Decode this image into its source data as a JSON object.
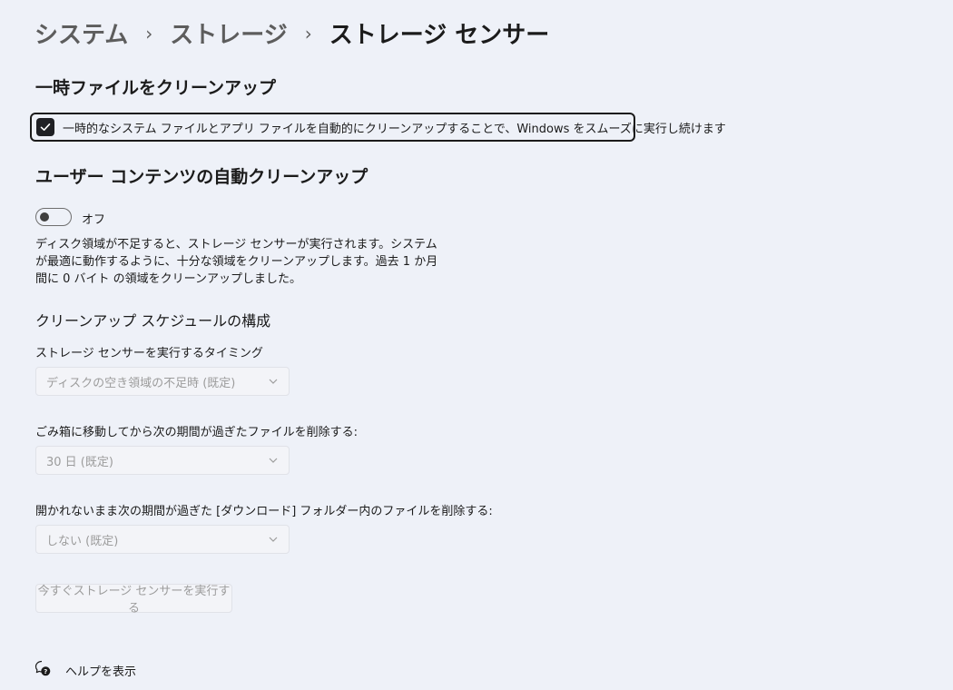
{
  "breadcrumb": {
    "items": [
      "システム",
      "ストレージ"
    ],
    "current": "ストレージ センサー",
    "separator": "›"
  },
  "temp_files": {
    "title": "一時ファイルをクリーンアップ",
    "checkbox_label": "一時的なシステム ファイルとアプリ ファイルを自動的にクリーンアップすることで、Windows をスムーズに実行し続けます",
    "checked": true
  },
  "user_content": {
    "title": "ユーザー コンテンツの自動クリーンアップ",
    "toggle_state": "オフ",
    "toggle_on": false,
    "description": "ディスク領域が不足すると、ストレージ センサーが実行されます。システムが最適に動作するように、十分な領域をクリーンアップします。過去 1 か月間に 0 バイト の領域をクリーンアップしました。"
  },
  "schedule": {
    "title": "クリーンアップ スケジュールの構成",
    "run_timing_label": "ストレージ センサーを実行するタイミング",
    "run_timing_value": "ディスクの空き領域の不足時 (既定)",
    "recycle_bin_label": "ごみ箱に移動してから次の期間が過ぎたファイルを削除する:",
    "recycle_bin_value": "30 日 (既定)",
    "downloads_label": "開かれないまま次の期間が過ぎた [ダウンロード] フォルダー内のファイルを削除する:",
    "downloads_value": "しない (既定)",
    "run_now_button": "今すぐストレージ センサーを実行する"
  },
  "help": {
    "label": "ヘルプを表示",
    "icon": "help-chat-icon"
  },
  "colors": {
    "background": "#eef1f8",
    "checkbox_fill": "#1f2024",
    "disabled_text": "#9c9c9c",
    "muted_breadcrumb": "#5d5d5d"
  }
}
